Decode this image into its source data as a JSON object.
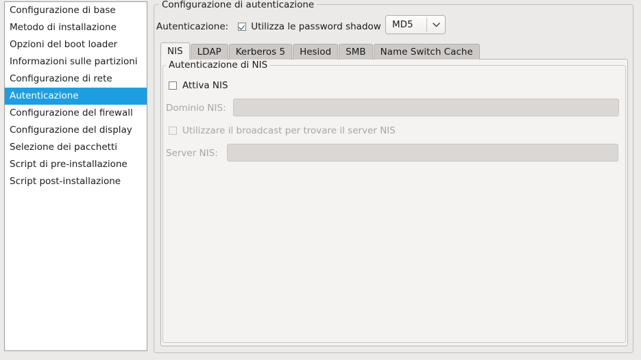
{
  "sidebar": {
    "items": [
      {
        "label": "Configurazione di base",
        "selected": false
      },
      {
        "label": "Metodo di installazione",
        "selected": false
      },
      {
        "label": "Opzioni del boot loader",
        "selected": false
      },
      {
        "label": "Informazioni sulle partizioni",
        "selected": false
      },
      {
        "label": "Configurazione di rete",
        "selected": false
      },
      {
        "label": "Autenticazione",
        "selected": true
      },
      {
        "label": "Configurazione del firewall",
        "selected": false
      },
      {
        "label": "Configurazione del display",
        "selected": false
      },
      {
        "label": "Selezione dei pacchetti",
        "selected": false
      },
      {
        "label": "Script di pre-installazione",
        "selected": false
      },
      {
        "label": "Script post-installazione",
        "selected": false
      }
    ]
  },
  "outer_group": {
    "title": "Configurazione di autenticazione"
  },
  "auth_row": {
    "label": "Autenticazione:",
    "shadow_checkbox_label": "Utilizza le password shadow",
    "shadow_checkbox_checked": true,
    "crypt_combo_value": "MD5",
    "crypt_combo_arrow": "⌄"
  },
  "tabs": [
    {
      "label": "NIS",
      "active": true
    },
    {
      "label": "LDAP",
      "active": false
    },
    {
      "label": "Kerberos 5",
      "active": false
    },
    {
      "label": "Hesiod",
      "active": false
    },
    {
      "label": "SMB",
      "active": false
    },
    {
      "label": "Name Switch Cache",
      "active": false
    }
  ],
  "nis_group": {
    "title": "Autenticazione di NIS",
    "enable_checkbox_label": "Attiva NIS",
    "enable_checkbox_checked": false,
    "domain_label": "Dominio NIS:",
    "domain_value": "",
    "domain_enabled": false,
    "broadcast_checkbox_label": "Utilizzare il broadcast per trovare il server NIS",
    "broadcast_checkbox_checked": false,
    "broadcast_enabled": false,
    "server_label": "Server NIS:",
    "server_value": "",
    "server_enabled": false
  },
  "colors": {
    "selection": "#1e9ee0",
    "window_background": "#ebeae8",
    "panel_background": "#f4f3f1",
    "disabled_field": "#dbd7d5",
    "disabled_text": "#a9a4a1"
  }
}
